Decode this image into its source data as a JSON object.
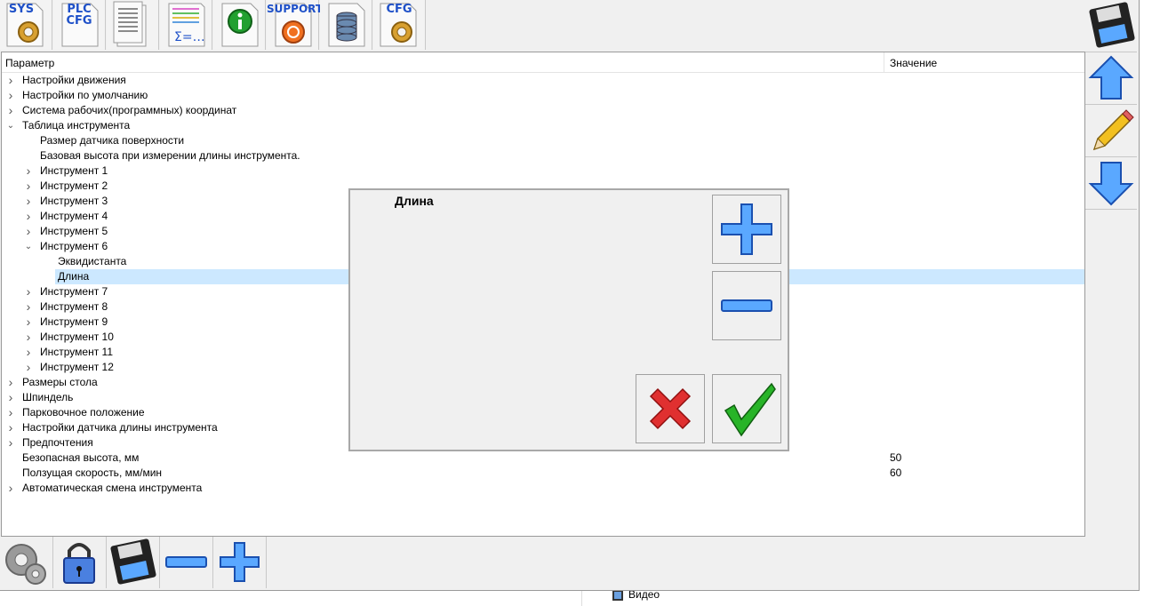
{
  "toolbar": {
    "sys_label": "SYS",
    "plc_label_1": "PLC",
    "plc_label_2": "CFG",
    "support_label": "SUPPORT",
    "cfg_label": "CFG"
  },
  "tree": {
    "col_param": "Параметр",
    "col_value": "Значение",
    "rows": [
      {
        "label": "Настройки движения",
        "level": 0,
        "arrow": "collapsed",
        "value": ""
      },
      {
        "label": "Настройки по умолчанию",
        "level": 0,
        "arrow": "collapsed",
        "value": ""
      },
      {
        "label": "Система рабочих(программных) координат",
        "level": 0,
        "arrow": "collapsed",
        "value": ""
      },
      {
        "label": "Таблица инструмента",
        "level": 0,
        "arrow": "expanded",
        "value": ""
      },
      {
        "label": "Размер датчика поверхности",
        "level": 1,
        "arrow": "none",
        "value": ""
      },
      {
        "label": "Базовая высота при измерении длины инструмента.",
        "level": 1,
        "arrow": "none",
        "value": ""
      },
      {
        "label": "Инструмент 1",
        "level": 1,
        "arrow": "collapsed",
        "value": ""
      },
      {
        "label": "Инструмент 2",
        "level": 1,
        "arrow": "collapsed",
        "value": ""
      },
      {
        "label": "Инструмент 3",
        "level": 1,
        "arrow": "collapsed",
        "value": ""
      },
      {
        "label": "Инструмент 4",
        "level": 1,
        "arrow": "collapsed",
        "value": ""
      },
      {
        "label": "Инструмент 5",
        "level": 1,
        "arrow": "collapsed",
        "value": ""
      },
      {
        "label": "Инструмент 6",
        "level": 1,
        "arrow": "expanded",
        "value": ""
      },
      {
        "label": "Эквидистанта",
        "level": 2,
        "arrow": "none",
        "value": ""
      },
      {
        "label": "Длина",
        "level": 2,
        "arrow": "none",
        "value": "",
        "selected": true
      },
      {
        "label": "Инструмент 7",
        "level": 1,
        "arrow": "collapsed",
        "value": ""
      },
      {
        "label": "Инструмент 8",
        "level": 1,
        "arrow": "collapsed",
        "value": ""
      },
      {
        "label": "Инструмент 9",
        "level": 1,
        "arrow": "collapsed",
        "value": ""
      },
      {
        "label": "Инструмент 10",
        "level": 1,
        "arrow": "collapsed",
        "value": ""
      },
      {
        "label": "Инструмент 11",
        "level": 1,
        "arrow": "collapsed",
        "value": ""
      },
      {
        "label": "Инструмент 12",
        "level": 1,
        "arrow": "collapsed",
        "value": ""
      },
      {
        "label": "Размеры стола",
        "level": 0,
        "arrow": "collapsed",
        "value": ""
      },
      {
        "label": "Шпиндель",
        "level": 0,
        "arrow": "collapsed",
        "value": ""
      },
      {
        "label": "Парковочное положение",
        "level": 0,
        "arrow": "collapsed",
        "value": ""
      },
      {
        "label": "Настройки датчика длины инструмента",
        "level": 0,
        "arrow": "collapsed",
        "value": ""
      },
      {
        "label": "Предпочтения",
        "level": 0,
        "arrow": "collapsed",
        "value": ""
      },
      {
        "label": "Безопасная высота, мм",
        "level": 0,
        "arrow": "none",
        "value": "50"
      },
      {
        "label": "Ползущая скорость, мм/мин",
        "level": 0,
        "arrow": "none",
        "value": "60"
      },
      {
        "label": "Автоматическая смена инструмента",
        "level": 0,
        "arrow": "collapsed",
        "value": ""
      }
    ]
  },
  "dialog": {
    "title": "Длина"
  },
  "taskbar": {
    "video_label": "Видео"
  },
  "colors": {
    "selection": "#cce8ff",
    "accent_blue": "#3a8ee8",
    "cancel_red": "#e03030",
    "ok_green": "#28b428"
  }
}
